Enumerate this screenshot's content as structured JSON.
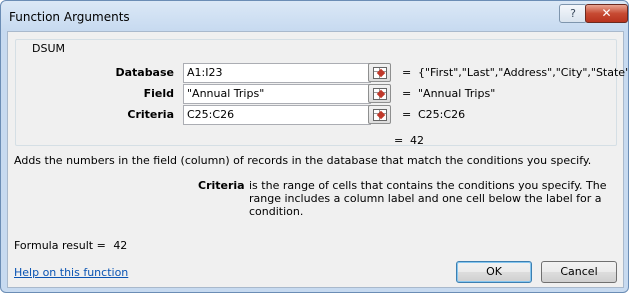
{
  "window": {
    "title": "Function Arguments",
    "help_glyph": "?",
    "close_glyph": "✕"
  },
  "group": {
    "label": "DSUM"
  },
  "args": [
    {
      "label": "Database",
      "value": "A1:I23",
      "result": "{\"First\",\"Last\",\"Address\",\"City\",\"State\",\"Zip..."
    },
    {
      "label": "Field",
      "value": "\"Annual Trips\"",
      "result": "\"Annual Trips\""
    },
    {
      "label": "Criteria",
      "value": "C25:C26",
      "result": "C25:C26"
    }
  ],
  "equals_sign": "=",
  "function_result": "42",
  "description": "Adds the numbers in the field (column) of records in the database that match the conditions you specify.",
  "arg_help": {
    "label": "Criteria",
    "text": "is the range of cells that contains the conditions you specify. The range includes a column label and one cell below the label for a condition."
  },
  "formula_result": {
    "label": "Formula result =",
    "value": "42"
  },
  "help_link": "Help on this function",
  "buttons": {
    "ok": "OK",
    "cancel": "Cancel"
  }
}
